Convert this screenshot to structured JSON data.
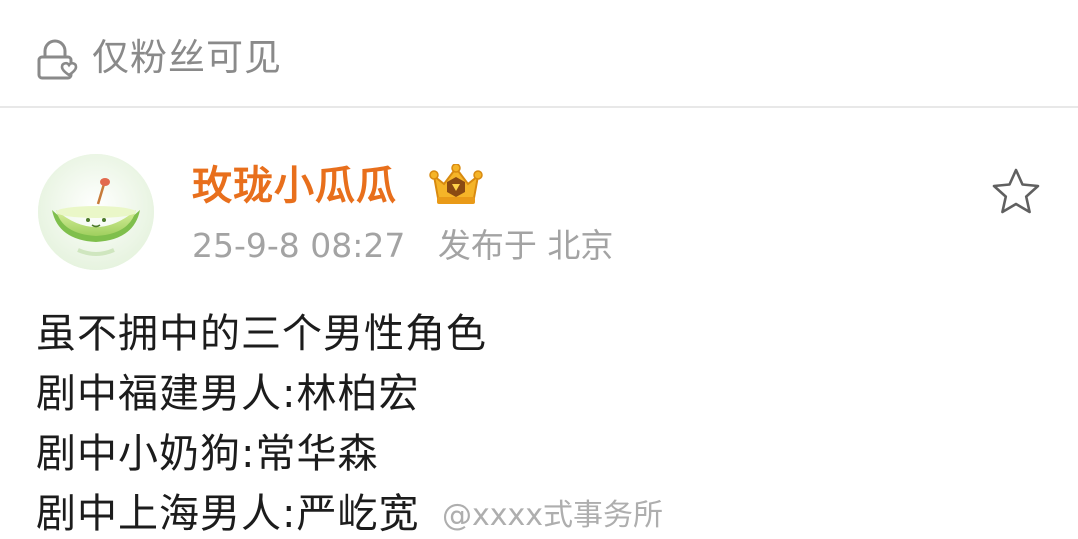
{
  "visibility": {
    "icon": "lock-heart-icon",
    "label": "仅粉丝可见"
  },
  "post": {
    "author": {
      "name": "玫珑小瓜瓜",
      "avatar_icon": "melon-avatar",
      "badge_icon": "vip-crown-badge-icon",
      "name_color": "#e86f1c"
    },
    "date": "25-9-8 08:27",
    "location": "发布于 北京",
    "favorite_icon": "star-icon",
    "lines": [
      "虽不拥中的三个男性角色",
      "剧中福建男人:林柏宏",
      "剧中小奶狗:常华森",
      "剧中上海男人:严屹宽"
    ]
  },
  "watermark": "@xxxx式事务所"
}
